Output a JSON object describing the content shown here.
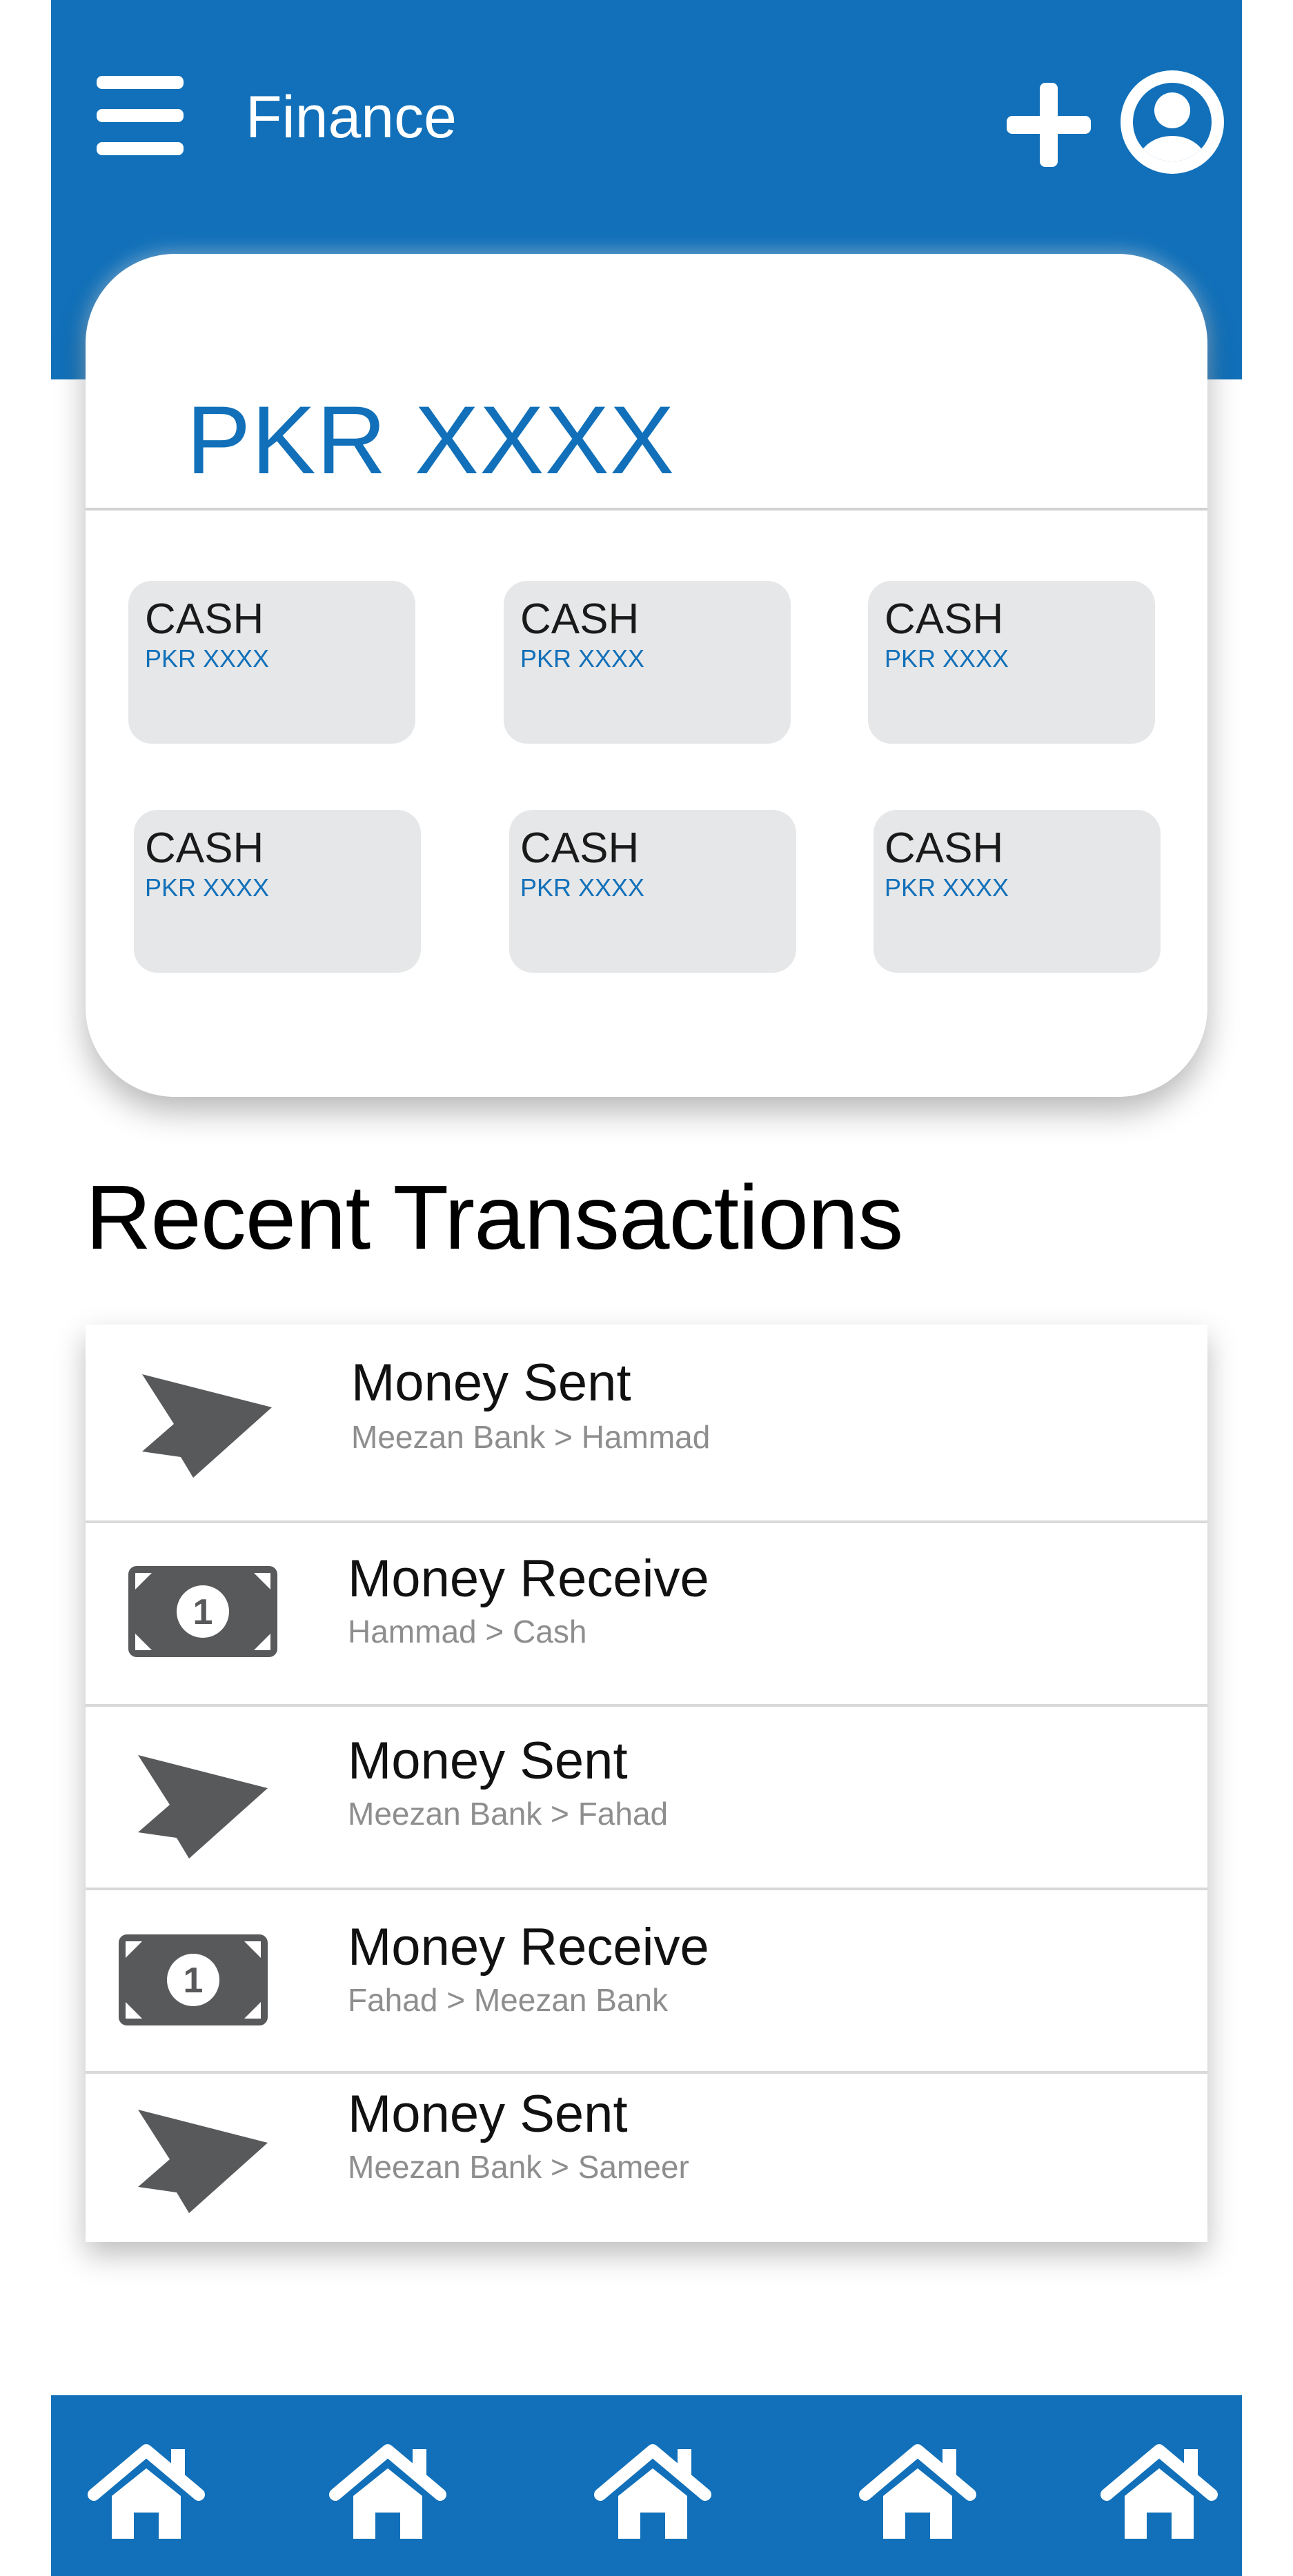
{
  "header": {
    "title": "Finance",
    "background_color": "#1170b9",
    "menu_icon": "hamburger-menu-icon",
    "add_icon": "plus-icon",
    "profile_icon": "user-avatar-icon"
  },
  "balance": {
    "total": "PKR XXXX",
    "accounts": [
      {
        "name": "CASH",
        "amount": "PKR XXXX"
      },
      {
        "name": "CASH",
        "amount": "PKR XXXX"
      },
      {
        "name": "CASH",
        "amount": "PKR XXXX"
      },
      {
        "name": "CASH",
        "amount": "PKR XXXX"
      },
      {
        "name": "CASH",
        "amount": "PKR XXXX"
      },
      {
        "name": "CASH",
        "amount": "PKR XXXX"
      }
    ]
  },
  "transactions": {
    "title": "Recent Transactions",
    "items": [
      {
        "type": "sent",
        "icon": "paper-plane-icon",
        "title": "Money Sent",
        "detail": "Meezan Bank > Hammad"
      },
      {
        "type": "received",
        "icon": "banknote-icon",
        "title": "Money Receive",
        "detail": "Hammad > Cash"
      },
      {
        "type": "sent",
        "icon": "paper-plane-icon",
        "title": "Money Sent",
        "detail": "Meezan Bank > Fahad"
      },
      {
        "type": "received",
        "icon": "banknote-icon",
        "title": "Money Receive",
        "detail": "Fahad > Meezan Bank"
      },
      {
        "type": "sent",
        "icon": "paper-plane-icon",
        "title": "Money Sent",
        "detail": "Meezan Bank > Sameer"
      }
    ]
  },
  "bottom_nav": {
    "items": [
      {
        "icon": "home-icon"
      },
      {
        "icon": "home-icon"
      },
      {
        "icon": "home-icon"
      },
      {
        "icon": "home-icon"
      },
      {
        "icon": "home-icon"
      }
    ]
  },
  "colors": {
    "primary": "#1170b9",
    "tile_background": "#e6e7e8",
    "icon_gray": "#58595b",
    "subtext_gray": "#8e8e8e"
  }
}
